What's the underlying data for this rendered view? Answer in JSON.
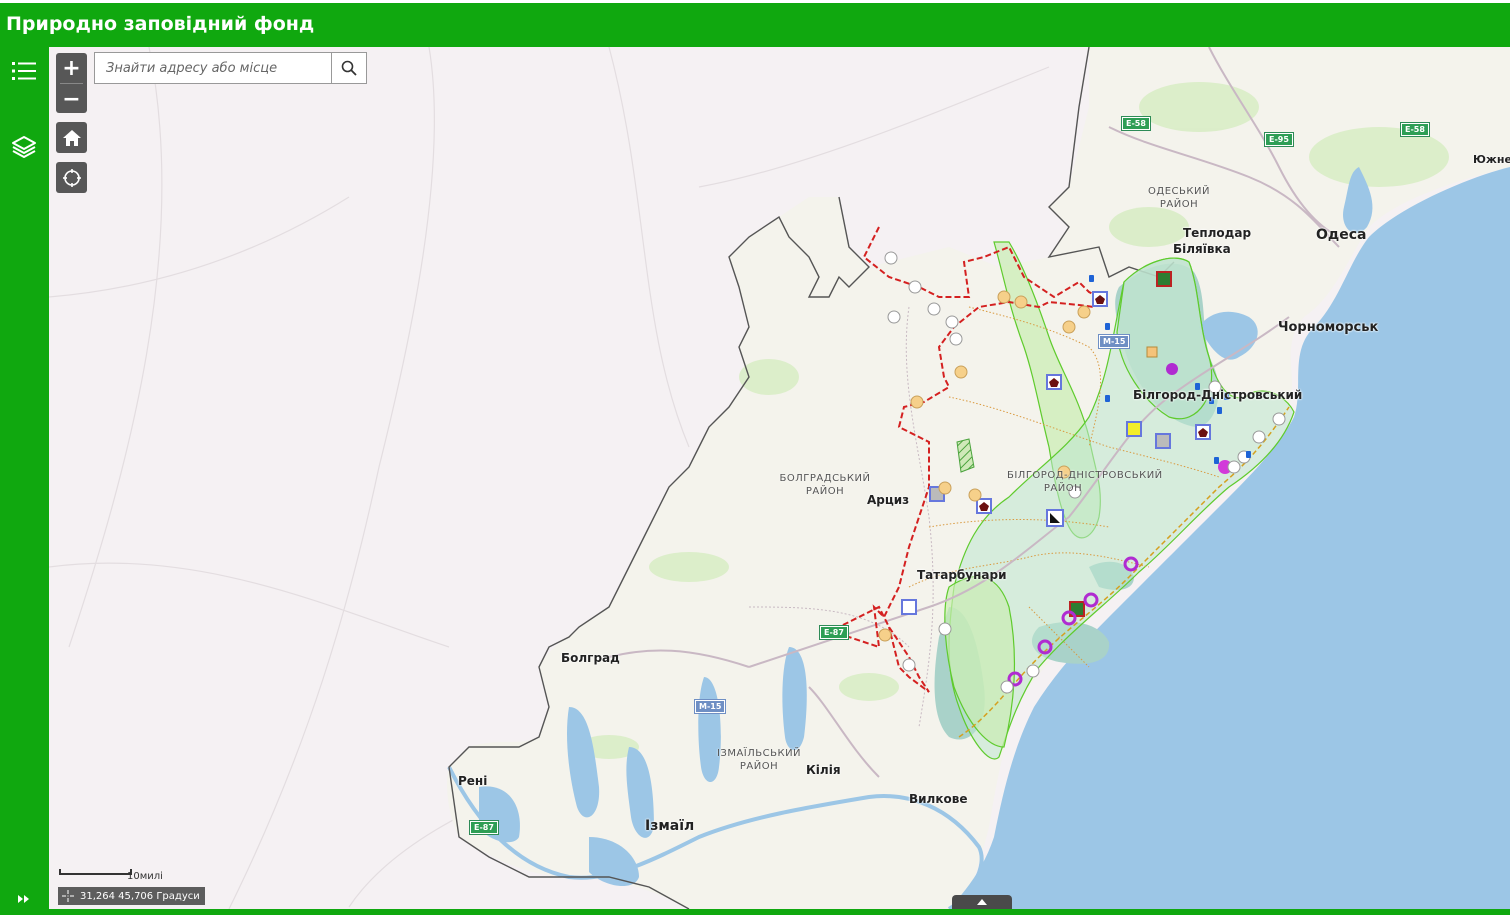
{
  "header": {
    "title": "Природно заповідний фонд"
  },
  "sidebar": {
    "items": [
      {
        "name": "list",
        "icon": "list-icon"
      },
      {
        "name": "layers",
        "icon": "layers-icon"
      }
    ],
    "collapse_icon": "double-chevron-right-icon"
  },
  "map": {
    "search": {
      "placeholder": "Знайти адресу або місце"
    },
    "zoom": {
      "in": "+",
      "out": "−"
    },
    "scale": {
      "label": "10милі"
    },
    "coordinates": {
      "text": "31,264 45,706 Градуси"
    },
    "labels": {
      "odesa": "Одеса",
      "chornomorsk": "Чорноморськ",
      "yuzhne": "Южне",
      "odeskyi_raion": "ОДЕСЬКИЙ\nРАЙОН",
      "teplodar": "Теплодар",
      "biliaivka": "Біляївка",
      "bilhorod": "Білгород-Дністровський",
      "bilhorod_raion": "БІЛГОРОД-ДНІСТРОВСЬКИЙ\nРАЙОН",
      "bolhrad_raion": "БОЛГРАДСЬКИЙ\nРАЙОН",
      "artsyz": "Арциз",
      "tatarbunary": "Татарбунари",
      "bolhrad": "Болград",
      "reni": "Рені",
      "izmail_raion": "ІЗМАЇЛЬСЬКИЙ\nРАЙОН",
      "kiliia": "Кілія",
      "vylkove": "Вилкове",
      "izmail": "Ізмаїл"
    },
    "roads": [
      "E-58",
      "E-95",
      "E-58",
      "M-15",
      "E-87",
      "M-15",
      "E-87"
    ],
    "colors": {
      "header": "#10a80f",
      "sea": "#9cc6e6",
      "boundary_protected": "#d42020",
      "protected_area": "#8fd47a"
    }
  }
}
